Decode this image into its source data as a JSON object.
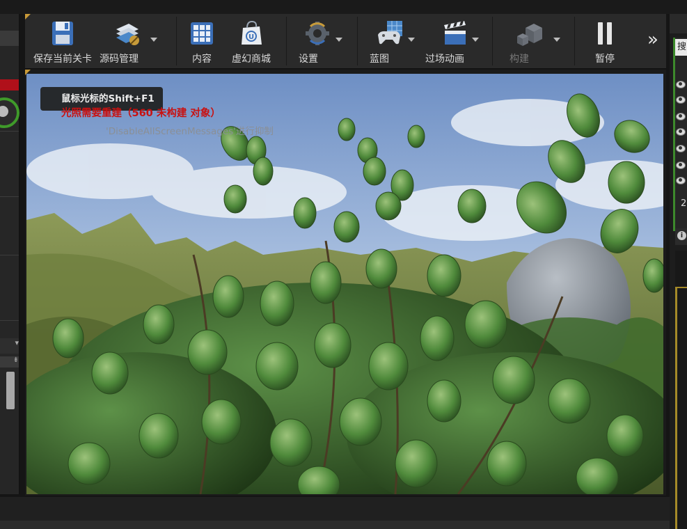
{
  "toolbar": {
    "buttons": [
      {
        "label": "保存当前关卡",
        "icon": "save-disk-icon",
        "has_menu": false,
        "enabled": true
      },
      {
        "label": "源码管理",
        "icon": "source-control-icon",
        "has_menu": true,
        "enabled": true
      },
      {
        "label": "内容",
        "icon": "content-grid-icon",
        "has_menu": false,
        "enabled": true
      },
      {
        "label": "虚幻商城",
        "icon": "marketplace-bag-icon",
        "has_menu": false,
        "enabled": true
      },
      {
        "label": "设置",
        "icon": "settings-gear-icon",
        "has_menu": true,
        "enabled": true
      },
      {
        "label": "蓝图",
        "icon": "blueprint-gamepad-icon",
        "has_menu": true,
        "enabled": true
      },
      {
        "label": "过场动画",
        "icon": "cinematics-clapper-icon",
        "has_menu": true,
        "enabled": true
      },
      {
        "label": "构建",
        "icon": "build-blocks-icon",
        "has_menu": true,
        "enabled": false
      },
      {
        "label": "暂停",
        "icon": "pause-icon",
        "has_menu": false,
        "enabled": true
      }
    ],
    "more_icon": "double-chevron-right-icon"
  },
  "viewport": {
    "hint": "鼠标光标的Shift+F1",
    "warning": "光照需要重建（560 未构建 对象）",
    "suppress_message": "'DisableAllScreenMessages'进行抑制"
  },
  "right_panel": {
    "search_text": "搜",
    "count_text": "2",
    "info_icon": "info-icon"
  },
  "colors": {
    "accent_green": "#3f9a2a",
    "warning_red": "#c81212",
    "highlight_yellow": "#a58a28"
  }
}
